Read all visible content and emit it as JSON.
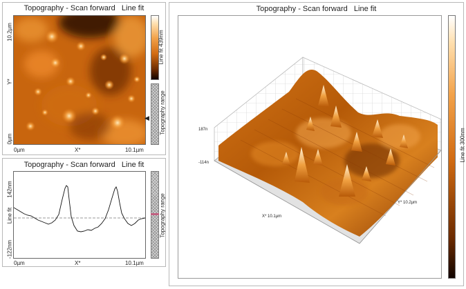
{
  "panel_2d": {
    "title": "Topography - Scan forward",
    "mode": "Line fit",
    "y_top": "10.2µm",
    "y_axis": "Y*",
    "y_bottom": "0µm",
    "x_left": "0µm",
    "x_axis": "X*",
    "x_right": "10.1µm",
    "colorbar_label": "Line fit 439nm",
    "range_label": "Topography range",
    "range_marker": "◀"
  },
  "panel_profile": {
    "title": "Topography - Scan forward",
    "mode": "Line fit",
    "y_top": "142nm",
    "y_axis": "Line fit",
    "y_bottom": "-122nm",
    "x_left": "0µm",
    "x_axis": "X*",
    "x_right": "10.1µm",
    "range_label": "Topography range"
  },
  "panel_3d": {
    "title": "Topography - Scan forward",
    "mode": "Line fit",
    "z_top": "187n",
    "z_bottom": "-114n",
    "x_axis": "X* 10.1µm",
    "y_axis": "Y* 10.2µm",
    "colorbar_label": "Line fit 300nm"
  },
  "colors": {
    "orange": "#e07a18",
    "dark": "#1a0a00",
    "light": "#ffe8c0",
    "gray": "#b8b8b8"
  }
}
